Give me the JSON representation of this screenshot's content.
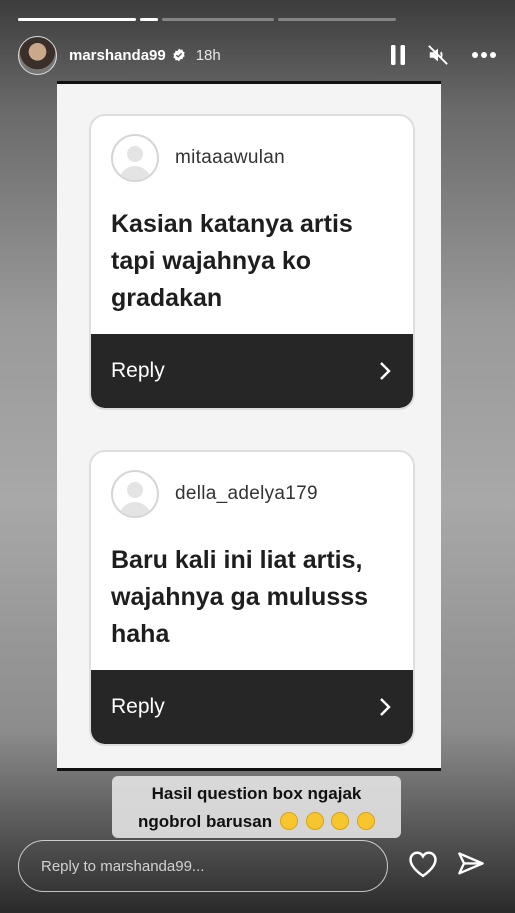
{
  "story": {
    "username": "marshanda99",
    "time": "18h",
    "segments": 4
  },
  "cards": [
    {
      "username": "mitaaawulan",
      "message": "Kasian katanya artis tapi wajahnya ko gradakan",
      "reply_label": "Reply"
    },
    {
      "username": "della_adelya179",
      "message": "Baru kali ini liat artis, wajahnya ga mulusss haha",
      "reply_label": "Reply"
    }
  ],
  "caption": {
    "line1": "Hasil question box ngajak",
    "line2": "ngobrol barusan",
    "emojis": [
      "crying-face",
      "flushed-face",
      "sad-face",
      "face-with-hand-over-mouth"
    ]
  },
  "reply": {
    "placeholder": "Reply to marshanda99..."
  },
  "icons": {
    "verified": "verified-badge-icon",
    "pause": "pause-icon",
    "mute": "speaker-muted-icon",
    "more": "more-options-icon",
    "heart": "heart-icon",
    "send": "send-icon",
    "chevron": "chevron-right-icon"
  },
  "colors": {
    "card_footer": "#262626",
    "verified": "#ffffff"
  }
}
